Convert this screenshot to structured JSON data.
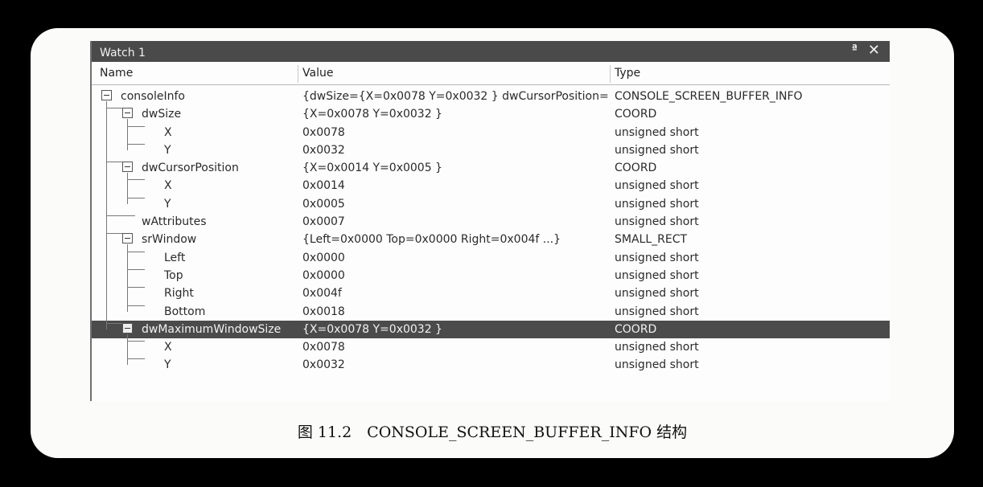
{
  "window": {
    "title": "Watch 1",
    "pin_glyph": "ª",
    "close_glyph": "✕"
  },
  "columns": {
    "name": "Name",
    "value": "Value",
    "type": "Type"
  },
  "rows": [
    {
      "name": "consoleInfo",
      "value": "{dwSize={X=0x0078 Y=0x0032 } dwCursorPosition=",
      "type": "CONSOLE_SCREEN_BUFFER_INFO",
      "level": 0,
      "expandable": true
    },
    {
      "name": "dwSize",
      "value": "{X=0x0078 Y=0x0032 }",
      "type": "COORD",
      "level": 1,
      "expandable": true
    },
    {
      "name": "X",
      "value": "0x0078",
      "type": "unsigned short",
      "level": 2,
      "expandable": false
    },
    {
      "name": "Y",
      "value": "0x0032",
      "type": "unsigned short",
      "level": 2,
      "expandable": false
    },
    {
      "name": "dwCursorPosition",
      "value": "{X=0x0014 Y=0x0005 }",
      "type": "COORD",
      "level": 1,
      "expandable": true
    },
    {
      "name": "X",
      "value": "0x0014",
      "type": "unsigned short",
      "level": 2,
      "expandable": false
    },
    {
      "name": "Y",
      "value": "0x0005",
      "type": "unsigned short",
      "level": 2,
      "expandable": false
    },
    {
      "name": "wAttributes",
      "value": "0x0007",
      "type": "unsigned short",
      "level": 1,
      "expandable": false
    },
    {
      "name": "srWindow",
      "value": "{Left=0x0000 Top=0x0000 Right=0x004f ...}",
      "type": "SMALL_RECT",
      "level": 1,
      "expandable": true
    },
    {
      "name": "Left",
      "value": "0x0000",
      "type": "unsigned short",
      "level": 2,
      "expandable": false
    },
    {
      "name": "Top",
      "value": "0x0000",
      "type": "unsigned short",
      "level": 2,
      "expandable": false
    },
    {
      "name": "Right",
      "value": "0x004f",
      "type": "unsigned short",
      "level": 2,
      "expandable": false
    },
    {
      "name": "Bottom",
      "value": "0x0018",
      "type": "unsigned short",
      "level": 2,
      "expandable": false
    },
    {
      "name": "dwMaximumWindowSize",
      "value": "{X=0x0078 Y=0x0032 }",
      "type": "COORD",
      "level": 1,
      "expandable": true,
      "selected": true
    },
    {
      "name": "X",
      "value": "0x0078",
      "type": "unsigned short",
      "level": 2,
      "expandable": false
    },
    {
      "name": "Y",
      "value": "0x0032",
      "type": "unsigned short",
      "level": 2,
      "expandable": false
    }
  ],
  "caption": "图 11.2　CONSOLE_SCREEN_BUFFER_INFO 结构",
  "colors": {
    "titlebar": "#4a4a4a",
    "selection": "#4b4b4b"
  }
}
